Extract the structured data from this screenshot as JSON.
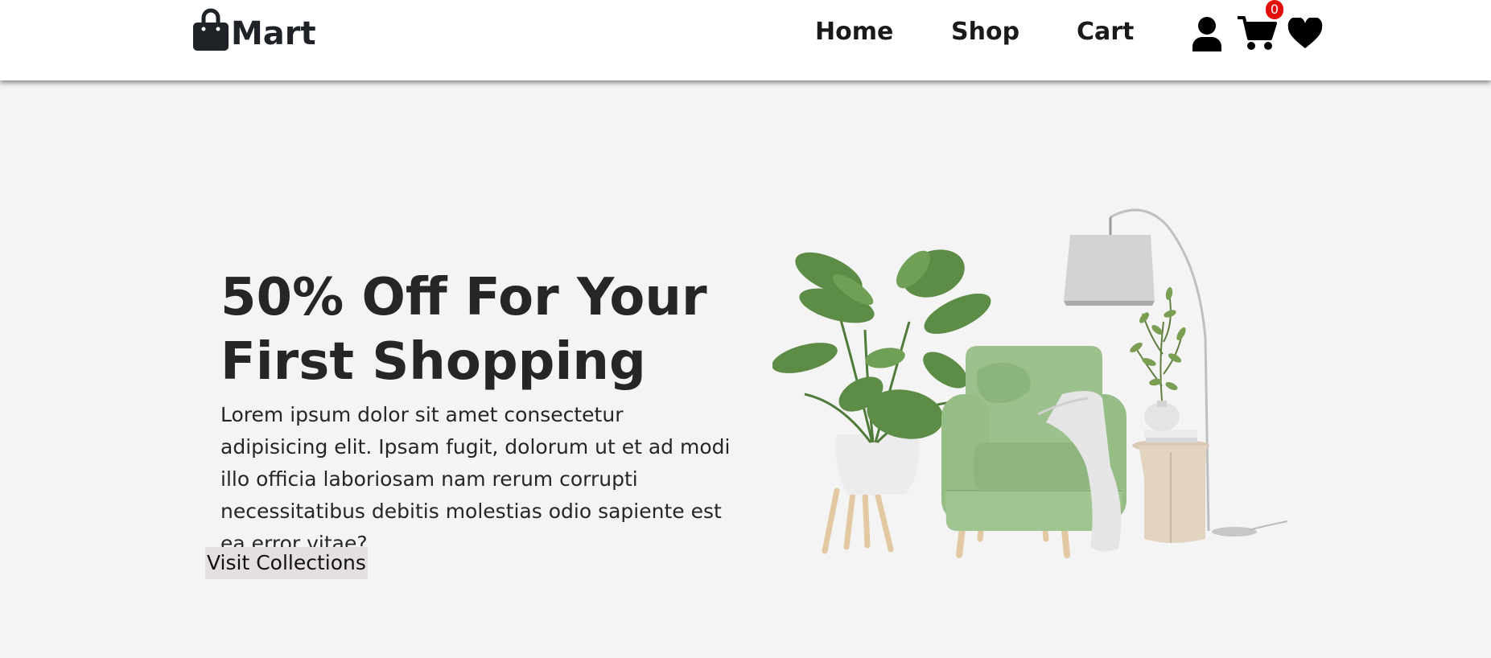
{
  "brand": {
    "name": "Mart",
    "icon": "shopping-bag-icon"
  },
  "nav": {
    "links": [
      {
        "label": "Home"
      },
      {
        "label": "Shop"
      },
      {
        "label": "Cart"
      }
    ],
    "icons": [
      "user-icon",
      "cart-icon",
      "heart-icon"
    ],
    "cart_count": "0"
  },
  "hero": {
    "title_line1": "50% Off For Your",
    "title_line2": "First Shopping",
    "description": "Lorem ipsum dolor sit amet consectetur adipisicing elit. Ipsam fugit, dolorum ut et ad modi illo officia laboriosam nam rerum corrupti necessitatibus debitis molestias odio sapiente est ea error vitae?",
    "button_label": "Visit Collections",
    "image": "armchair-plant-lamp-illustration"
  },
  "colors": {
    "background": "#f4f4f4",
    "navbar": "#ffffff",
    "badge": "#e20f0f",
    "button_bg": "#e3dfe3",
    "chair": "#95be85",
    "text": "#252628"
  }
}
